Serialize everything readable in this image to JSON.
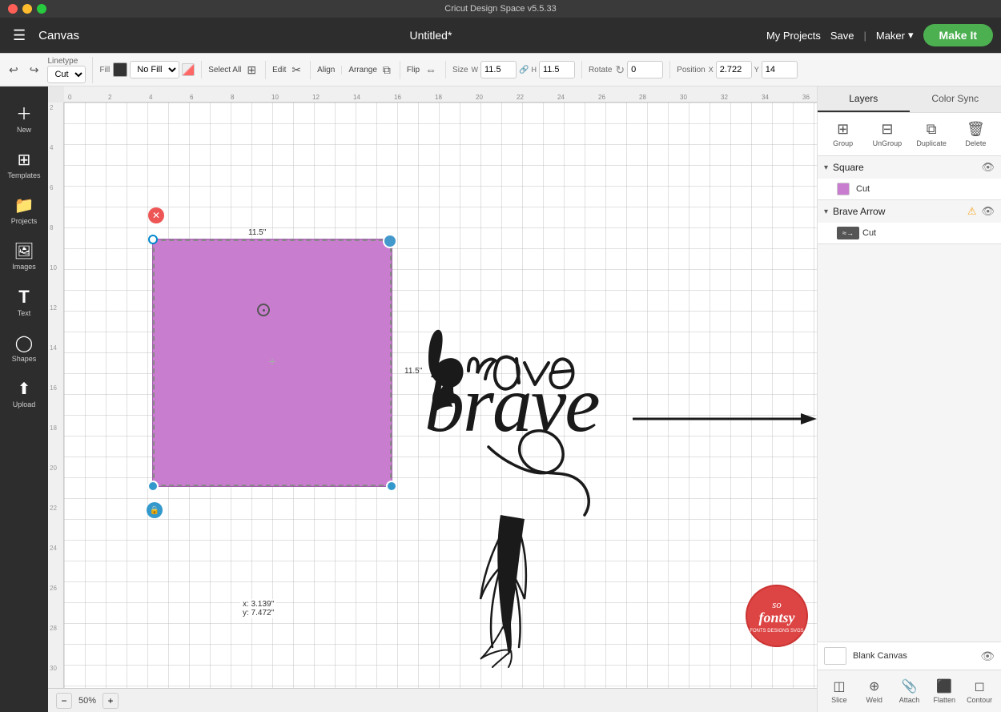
{
  "titlebar": {
    "title": "Cricut Design Space  v5.5.33"
  },
  "menubar": {
    "app_name": "Canvas",
    "project_name": "Untitled*",
    "my_projects": "My Projects",
    "save": "Save",
    "divider": "|",
    "maker": "Maker",
    "make_it": "Make It"
  },
  "toolbar": {
    "linetype_label": "Linetype",
    "linetype_value": "Cut",
    "fill_label": "Fill",
    "fill_value": "No Fill",
    "select_all_label": "Select All",
    "edit_label": "Edit",
    "align_label": "Align",
    "arrange_label": "Arrange",
    "flip_label": "Flip",
    "size_label": "Size",
    "w_label": "W",
    "w_value": "11.5",
    "h_label": "H",
    "h_value": "11.5",
    "rotate_label": "Rotate",
    "rotate_value": "0",
    "position_label": "Position",
    "x_label": "X",
    "x_value": "2.722",
    "y_label": "Y",
    "y_value": "14"
  },
  "canvas": {
    "dim_top": "11.5\"",
    "dim_right": "11.5\"",
    "coords": "x: 3.139\"\ny: 7.472\"",
    "zoom_level": "50%",
    "zoom_minus": "−",
    "zoom_plus": "+"
  },
  "layers_panel": {
    "tabs": [
      {
        "label": "Layers",
        "active": true
      },
      {
        "label": "Color Sync",
        "active": false
      }
    ],
    "actions": [
      {
        "label": "Group",
        "icon": "⊞"
      },
      {
        "label": "UnGroup",
        "icon": "⊟"
      },
      {
        "label": "Duplicate",
        "icon": "⧉"
      },
      {
        "label": "Delete",
        "icon": "🗑"
      }
    ],
    "groups": [
      {
        "name": "Square",
        "expanded": true,
        "eye": true,
        "warning": false,
        "items": [
          {
            "color": "#c97dcf",
            "icon": "✂",
            "label": "Cut"
          }
        ]
      },
      {
        "name": "Brave Arrow",
        "expanded": true,
        "eye": true,
        "warning": true,
        "items": [
          {
            "color": "#333",
            "icon": "≈→",
            "label": "Cut"
          }
        ]
      }
    ],
    "blank_canvas_label": "Blank Canvas",
    "bottom_actions": [
      {
        "label": "Slice",
        "icon": "◫"
      },
      {
        "label": "Weld",
        "icon": "⊕"
      },
      {
        "label": "Attach",
        "icon": "📎"
      },
      {
        "label": "Flatten",
        "icon": "⬛"
      },
      {
        "label": "Contour",
        "icon": "◻"
      }
    ]
  },
  "left_sidebar": {
    "items": [
      {
        "label": "New",
        "icon": "+"
      },
      {
        "label": "Templates",
        "icon": "⊞"
      },
      {
        "label": "Projects",
        "icon": "📁"
      },
      {
        "label": "Images",
        "icon": "🖼"
      },
      {
        "label": "Text",
        "icon": "T"
      },
      {
        "label": "Shapes",
        "icon": "○"
      },
      {
        "label": "Upload",
        "icon": "⬆"
      }
    ]
  }
}
